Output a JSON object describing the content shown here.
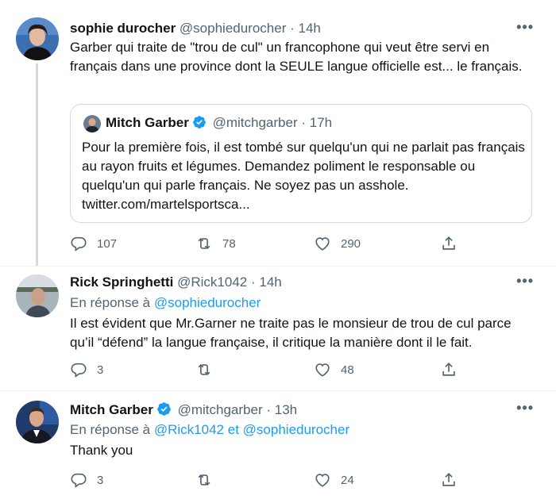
{
  "tweets": [
    {
      "name": "sophie durocher",
      "handle": "@sophiedurocher",
      "dot": "·",
      "time": "14h",
      "more": "•••",
      "text": "Garber qui traite de \"trou de cul\" un francophone qui veut être servi en français dans une province dont la SEULE langue officielle est... le français.",
      "quote": {
        "name": "Mitch Garber",
        "handle": "@mitchgarber",
        "dot": "·",
        "time": "17h",
        "text": "Pour la première fois, il est tombé sur quelqu'un qui ne parlait pas français au rayon fruits et légumes. Demandez poliment le responsable ou quelqu'un qui parle français. Ne soyez pas un asshole. twitter.com/martelsportsca..."
      },
      "replies": "107",
      "retweets": "78",
      "likes": "290"
    },
    {
      "name": "Rick Springhetti",
      "handle": "@Rick1042",
      "dot": "·",
      "time": "14h",
      "more": "•••",
      "reply_prefix": "En réponse à",
      "reply_to": "@sophiedurocher",
      "text": "Il est évident que Mr.Garner ne traite pas le monsieur de trou de cul parce qu’il “défend” la langue française, il critique la manière dont il le fait.",
      "replies": "3",
      "retweets": "",
      "likes": "48"
    },
    {
      "name": "Mitch Garber",
      "handle": "@mitchgarber",
      "dot": "·",
      "time": "13h",
      "more": "•••",
      "reply_prefix": "En réponse à",
      "reply_to_1": "@Rick1042",
      "reply_and": "et",
      "reply_to_2": "@sophiedurocher",
      "text": "Thank you",
      "replies": "3",
      "retweets": "",
      "likes": "24"
    }
  ],
  "colors": {
    "accent": "#1d9bf0",
    "secondary_text": "#536471",
    "primary_text": "#0f1419",
    "border": "#cfd9de"
  }
}
